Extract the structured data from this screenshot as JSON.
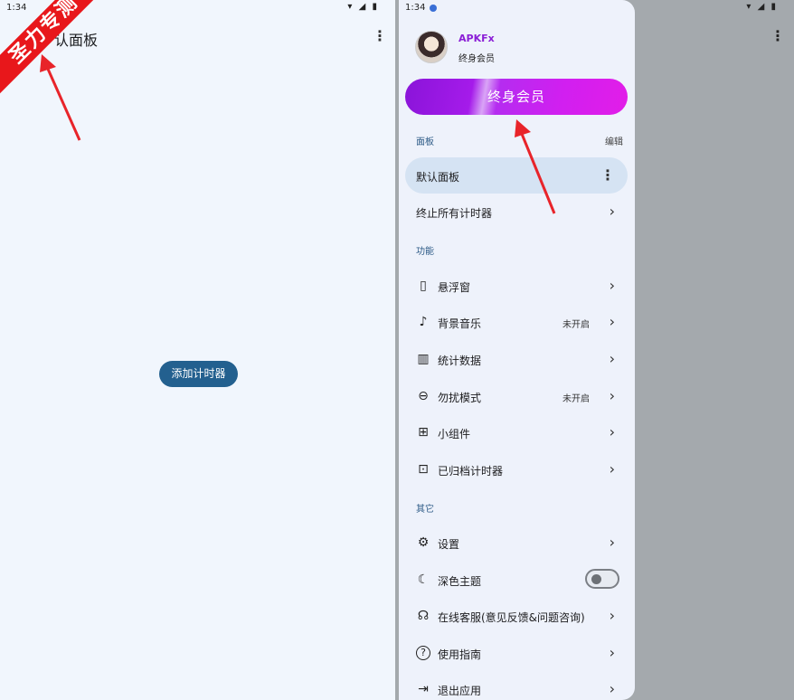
{
  "left": {
    "status": {
      "time": "1:34",
      "icons": "▾ ◢ ▮"
    },
    "title": "默认面板",
    "title_visible": "认面板",
    "more_icon": "⋮",
    "add_button": "添加计时器",
    "watermark": "圣力专测"
  },
  "right": {
    "status": {
      "time": "1:34",
      "icons": "▾ ◢ ▮"
    },
    "more_icon": "⋮"
  },
  "drawer": {
    "user": {
      "name": "APKFx",
      "level": "终身会员"
    },
    "vip_button": "终身会员",
    "sections": {
      "panels": "面板",
      "panels_edit": "编辑",
      "features": "功能",
      "other": "其它"
    },
    "panel_items": [
      {
        "label": "默认面板"
      },
      {
        "label": "终止所有计时器"
      }
    ],
    "feature_items": [
      {
        "label": "悬浮窗",
        "icon": "floating-window-icon",
        "glyph": "▯",
        "value": ""
      },
      {
        "label": "背景音乐",
        "icon": "music-note-icon",
        "glyph": "♪",
        "value": "未开启"
      },
      {
        "label": "统计数据",
        "icon": "statistics-icon",
        "glyph": "▥",
        "value": ""
      },
      {
        "label": "勿扰模式",
        "icon": "do-not-disturb-icon",
        "glyph": "⊖",
        "value": "未开启"
      },
      {
        "label": "小组件",
        "icon": "widgets-icon",
        "glyph": "⊞",
        "value": ""
      },
      {
        "label": "已归档计时器",
        "icon": "archive-icon",
        "glyph": "⊡",
        "value": ""
      }
    ],
    "other_items": [
      {
        "label": "设置",
        "icon": "gear-icon",
        "glyph": "⚙"
      },
      {
        "label": "深色主题",
        "icon": "moon-icon",
        "glyph": "☾"
      },
      {
        "label": "在线客服(意见反馈&问题咨询)",
        "icon": "support-icon",
        "glyph": "☊"
      },
      {
        "label": "使用指南",
        "icon": "help-icon",
        "glyph": "?"
      },
      {
        "label": "退出应用",
        "icon": "exit-icon",
        "glyph": "⇥"
      }
    ],
    "dark_theme_on": false,
    "chevron": "›",
    "dots": "⋮"
  },
  "colors": {
    "accent": "#23608f",
    "vip_purple": "#a51bea",
    "watermark_red": "#e8171b",
    "arrow_red": "#e8242a"
  }
}
